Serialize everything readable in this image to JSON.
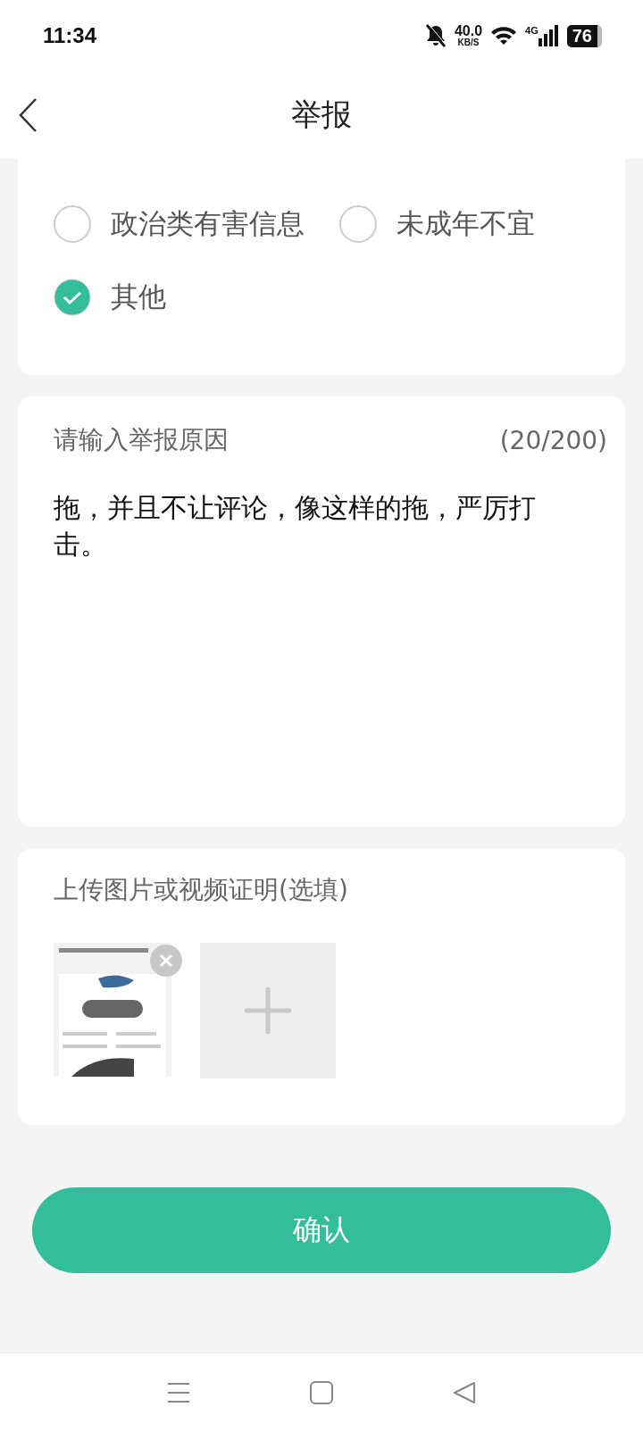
{
  "status_bar": {
    "time": "11:34",
    "speed": "40.0",
    "speed_unit": "KB/S",
    "network": "4G",
    "battery": "76"
  },
  "header": {
    "title": "举报"
  },
  "reasons": [
    {
      "label": "政治类有害信息",
      "selected": false
    },
    {
      "label": "未成年不宜",
      "selected": false
    },
    {
      "label": "其他",
      "selected": true
    }
  ],
  "reason_input": {
    "label": "请输入举报原因",
    "counter": "(20/200)",
    "value": "拖，并且不让评论，像这样的拖，严厉打击。"
  },
  "upload": {
    "title": "上传图片或视频证明(选填)",
    "items": [
      {
        "kind": "picture"
      },
      {
        "kind": "add"
      }
    ]
  },
  "confirm_button": "确认"
}
